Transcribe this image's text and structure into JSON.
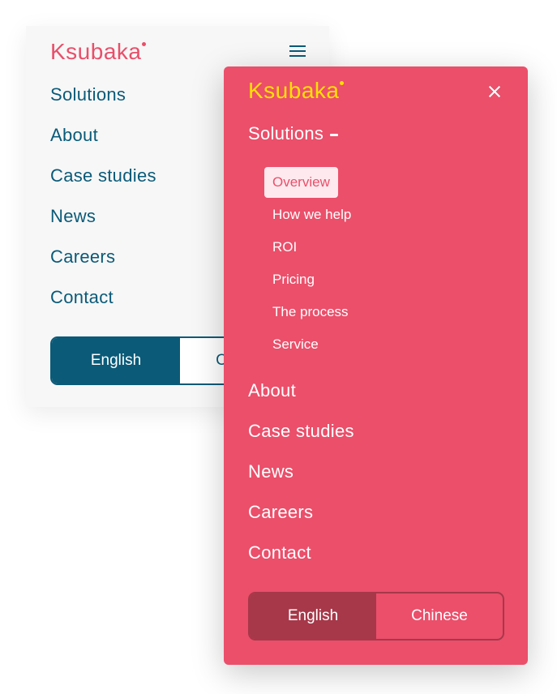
{
  "brand": {
    "name": "Ksubaka",
    "colors": {
      "pink": "#eb4f6a",
      "teal": "#0a5a78",
      "yellow": "#ffe000",
      "dark_pink": "#a63849",
      "light_bg": "#f7f7f7"
    }
  },
  "collapsed_menu": {
    "logo": "Ksubaka",
    "menu_icon": "hamburger-icon",
    "nav": [
      "Solutions",
      "About",
      "Case studies",
      "News",
      "Careers",
      "Contact"
    ],
    "languages": [
      {
        "label": "English",
        "active": true
      },
      {
        "label": "Chinese",
        "active": false
      }
    ]
  },
  "expanded_menu": {
    "logo": "Ksubaka",
    "close_icon": "close-icon",
    "solutions": {
      "label": "Solutions",
      "toggle_icon": "minus-icon",
      "items": [
        {
          "label": "Overview",
          "active": true
        },
        {
          "label": "How we help"
        },
        {
          "label": "ROI"
        },
        {
          "label": "Pricing"
        },
        {
          "label": "The process"
        },
        {
          "label": "Service"
        }
      ]
    },
    "nav": [
      "About",
      "Case studies",
      "News",
      "Careers",
      "Contact"
    ],
    "languages": [
      {
        "label": "English",
        "active": true
      },
      {
        "label": "Chinese",
        "active": false
      }
    ]
  }
}
